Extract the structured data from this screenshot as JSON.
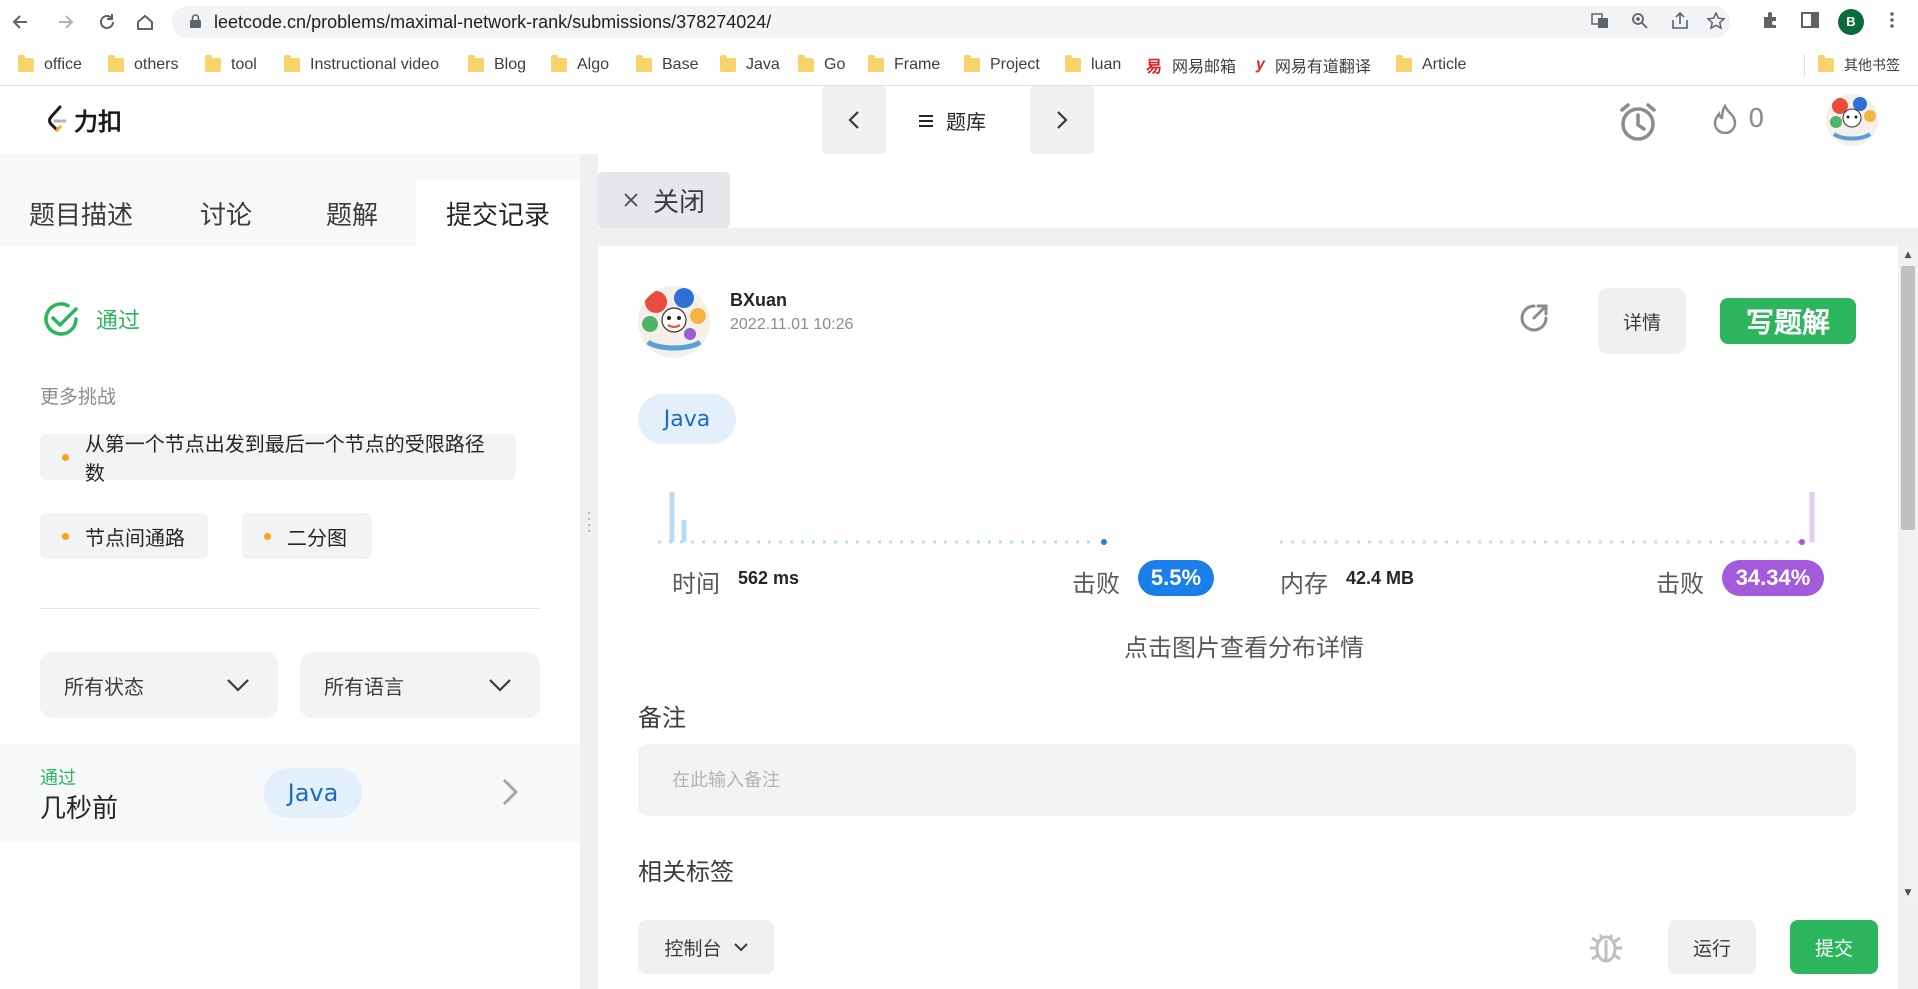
{
  "browser": {
    "url": "leetcode.cn/problems/maximal-network-rank/submissions/378274024/",
    "profile_initial": "B",
    "bookmarks": [
      {
        "label": "office",
        "icon": "folder-icon"
      },
      {
        "label": "others",
        "icon": "folder-icon"
      },
      {
        "label": "tool",
        "icon": "folder-icon"
      },
      {
        "label": "Instructional video",
        "icon": "folder-icon"
      },
      {
        "label": "Blog",
        "icon": "folder-icon"
      },
      {
        "label": "Algo",
        "icon": "folder-icon"
      },
      {
        "label": "Base",
        "icon": "folder-icon"
      },
      {
        "label": "Java",
        "icon": "folder-icon"
      },
      {
        "label": "Go",
        "icon": "folder-icon"
      },
      {
        "label": "Frame",
        "icon": "folder-icon"
      },
      {
        "label": "Project",
        "icon": "folder-icon"
      },
      {
        "label": "luan",
        "icon": "folder-icon"
      },
      {
        "label": "网易邮箱",
        "icon": "netease-mail-icon"
      },
      {
        "label": "网易有道翻译",
        "icon": "youdao-icon"
      },
      {
        "label": "Article",
        "icon": "folder-icon"
      }
    ],
    "other_bookmarks": "其他书签"
  },
  "header": {
    "logo_text": "力扣",
    "problem_bank": "题库",
    "streak_count": "0"
  },
  "tabs": [
    "题目描述",
    "讨论",
    "题解",
    "提交记录"
  ],
  "close_tab": "关闭",
  "left": {
    "status": "通过",
    "more_challenges": "更多挑战",
    "challenges": [
      "从第一个节点出发到最后一个节点的受限路径数",
      "节点间通路",
      "二分图"
    ],
    "filter_status": "所有状态",
    "filter_language": "所有语言",
    "submission": {
      "status": "通过",
      "time": "几秒前",
      "language": "Java"
    }
  },
  "submission": {
    "username": "BXuan",
    "datetime": "2022.11.01 10:26",
    "detail_button": "详情",
    "write_solution_button": "写题解",
    "language": "Java",
    "time_label": "时间",
    "time_value": "562 ms",
    "time_beat_label": "击败",
    "time_beat": "5.5%",
    "memory_label": "内存",
    "memory_value": "42.4 MB",
    "memory_beat_label": "击败",
    "memory_beat": "34.34%",
    "distribution_hint": "点击图片查看分布详情",
    "note_title": "备注",
    "note_placeholder": "在此输入备注",
    "tags_title": "相关标签"
  },
  "colors": {
    "accent_green": "#2db55d",
    "time_blue": "#1a7fe8",
    "memory_purple": "#a35bdb",
    "java_blue": "#1e6ac5"
  },
  "bottom": {
    "console": "控制台",
    "run": "运行",
    "submit": "提交"
  }
}
